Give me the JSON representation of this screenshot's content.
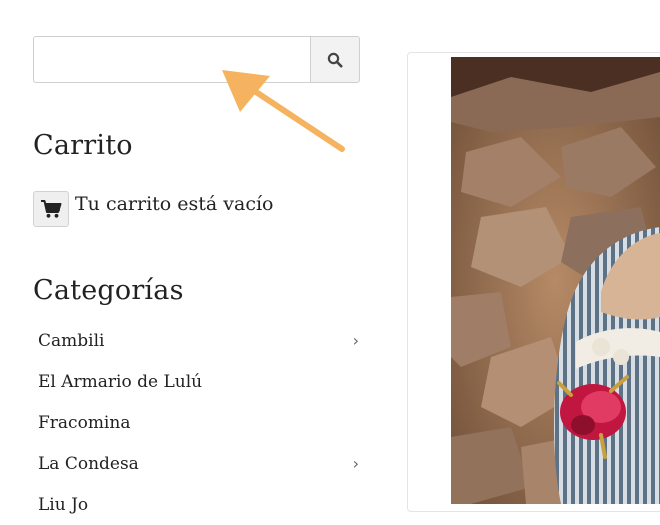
{
  "search": {
    "placeholder": "",
    "value": ""
  },
  "cart": {
    "title": "Carrito",
    "empty_text": "Tu carrito está vacío"
  },
  "categories": {
    "title": "Categorías",
    "items": [
      {
        "label": "Cambili",
        "has_children": true
      },
      {
        "label": "El Armario de Lulú",
        "has_children": false
      },
      {
        "label": "Fracomina",
        "has_children": false
      },
      {
        "label": "La Condesa",
        "has_children": true
      },
      {
        "label": "Liu Jo",
        "has_children": false
      }
    ]
  },
  "colors": {
    "accent_arrow": "#f5b360",
    "border": "#cfcfcf",
    "button_bg": "#f2f2f2"
  },
  "icons": {
    "search": "search-icon",
    "cart": "cart-icon",
    "chevron": "chevron-right-icon"
  }
}
